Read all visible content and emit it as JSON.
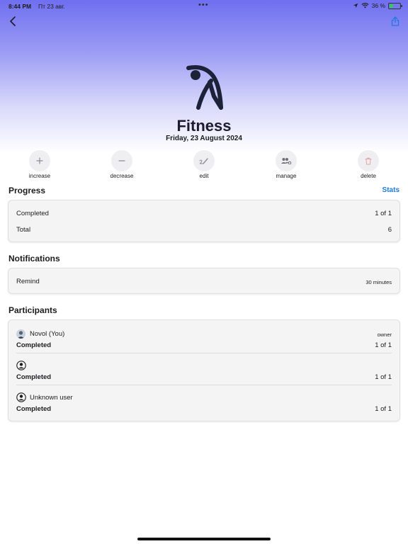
{
  "status_bar": {
    "time": "8:44 PM",
    "date": "Пт 23 авг.",
    "battery_text": "36 %",
    "battery_level": 0.36
  },
  "header": {
    "title": "Fitness",
    "subtitle": "Friday, 23 August 2024",
    "hero_icon": "stretching-person-icon"
  },
  "actions": [
    {
      "label": "increase",
      "icon": "plus-icon"
    },
    {
      "label": "decrease",
      "icon": "minus-icon"
    },
    {
      "label": "edit",
      "icon": "pencil-icon"
    },
    {
      "label": "manage",
      "icon": "people-gear-icon"
    },
    {
      "label": "delete",
      "icon": "trash-icon"
    }
  ],
  "progress": {
    "title": "Progress",
    "stats_link": "Stats",
    "rows": [
      {
        "label": "Completed",
        "value": "1 of 1"
      },
      {
        "label": "Total",
        "value": "6"
      }
    ]
  },
  "notifications": {
    "title": "Notifications",
    "rows": [
      {
        "label": "Remind",
        "value": "30 minutes"
      }
    ]
  },
  "participants": {
    "title": "Participants",
    "items": [
      {
        "name": "Novol (You)",
        "role": "owner",
        "status_label": "Completed",
        "status_value": "1 of 1"
      },
      {
        "name": "",
        "role": "",
        "status_label": "Completed",
        "status_value": "1 of 1"
      },
      {
        "name": "Unknown user",
        "role": "",
        "status_label": "Completed",
        "status_value": "1 of 1"
      }
    ]
  },
  "colors": {
    "accent": "#1f7ae0",
    "header_gradient_top": "#6f6ff0",
    "delete": "#e8a0a8"
  }
}
